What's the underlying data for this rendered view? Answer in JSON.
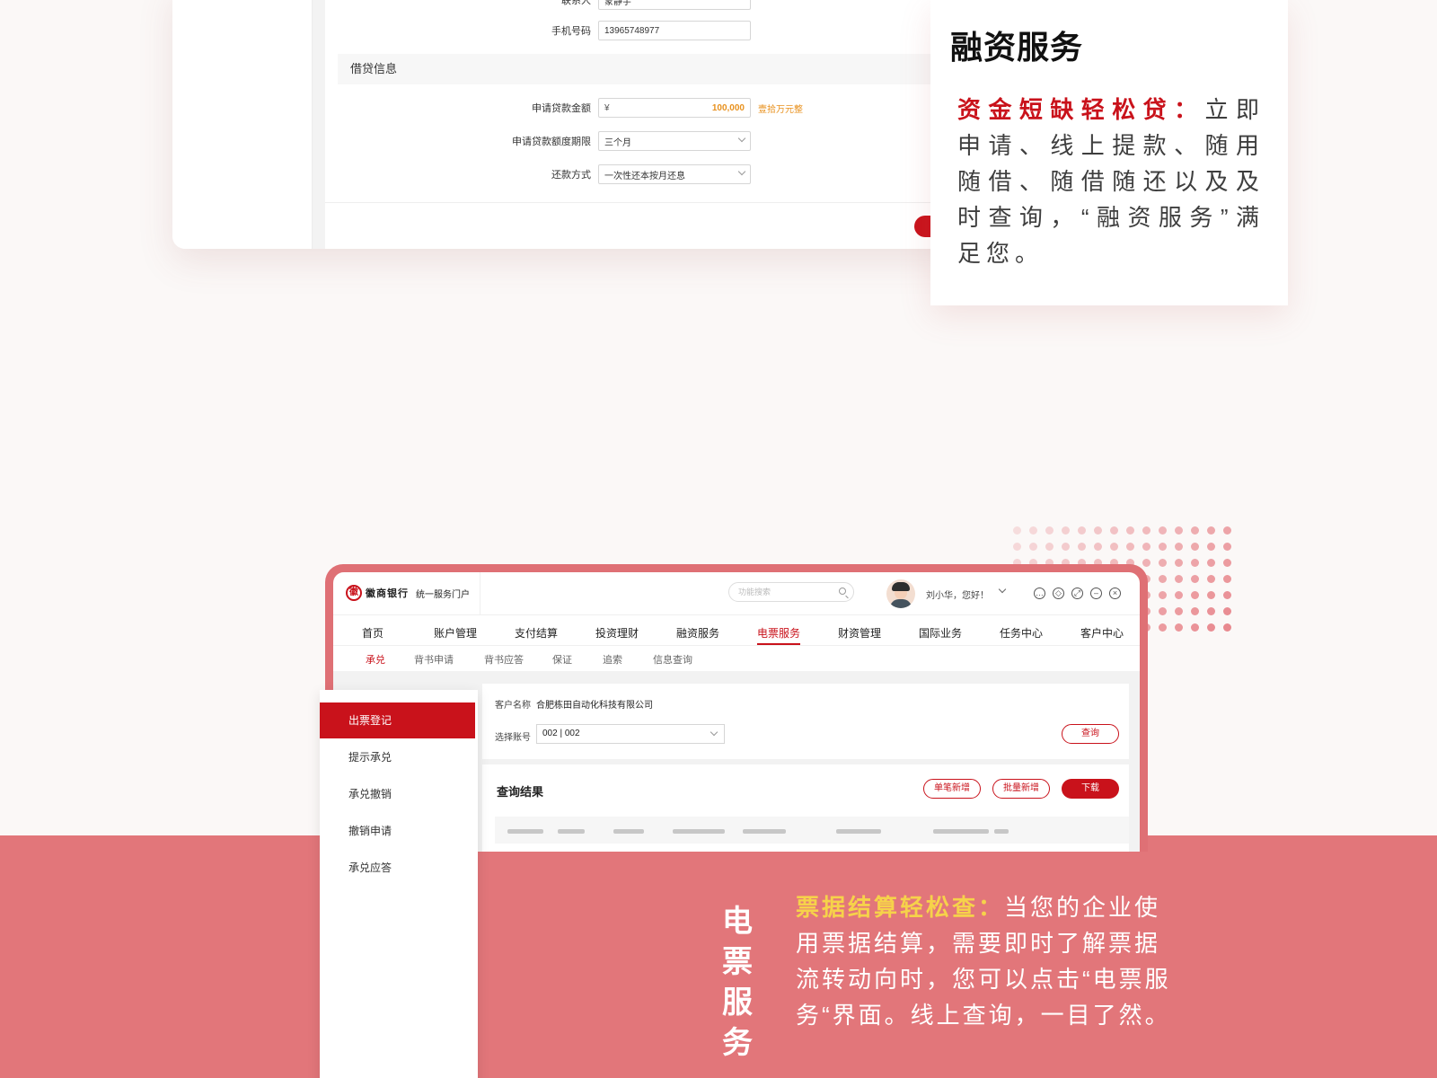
{
  "loan_form": {
    "partial_label": "联系人",
    "partial_value": "蒙静宇",
    "phone_label": "手机号码",
    "phone_value": "13965748977",
    "section_title": "借贷信息",
    "amount_label": "申请贷款金额",
    "amount_currency": "¥",
    "amount_value": "100,000",
    "amount_hint": "壹拾万元整",
    "term_label": "申请贷款额度期限",
    "term_value": "三个月",
    "repay_label": "还款方式",
    "repay_value": "一次性还本按月还息"
  },
  "financing_card": {
    "title": "融资服务",
    "highlight": "资金短缺轻松贷：",
    "body": "立即申请、线上提款、随用随借、随借随还以及及时查询，“融资服务”满足您。"
  },
  "portal": {
    "logo_mark": "徽",
    "logo_text": "徽商银行",
    "logo_sub": "统一服务门户",
    "search_placeholder": "功能搜索",
    "greeting": "刘小华，您好！",
    "main_nav": [
      "首页",
      "账户管理",
      "支付结算",
      "投资理财",
      "融资服务",
      "电票服务",
      "财资管理",
      "国际业务",
      "任务中心",
      "客户中心"
    ],
    "main_nav_active": "电票服务",
    "sub_nav": [
      "承兑",
      "背书申请",
      "背书应答",
      "保证",
      "追索",
      "信息查询"
    ],
    "sub_nav_active": "承兑",
    "customer_label": "客户名称",
    "customer_value": "合肥栋田自动化科技有限公司",
    "account_label": "选择账号",
    "account_value": "002 | 002",
    "query_button": "查询",
    "result_title": "查询结果",
    "single_add_button": "单笔新增",
    "batch_add_button": "批量新增",
    "download_button": "下载"
  },
  "sidebar": {
    "items": [
      "出票登记",
      "提示承兑",
      "承兑撤销",
      "撤销申请",
      "承兑应答"
    ],
    "active": "出票登记"
  },
  "eticket": {
    "vertical_title": [
      "电",
      "票",
      "服",
      "务"
    ],
    "highlight": "票据结算轻松查：",
    "body": "当您的企业使用票据结算，需要即时了解票据流转动向时，您可以点击“电票服务“界面。线上查询，一目了然。"
  },
  "colors": {
    "brand_red": "#c9121b",
    "band": "#e2767a",
    "highlight_yellow": "#f6d24a",
    "amount_orange": "#e8911e"
  }
}
